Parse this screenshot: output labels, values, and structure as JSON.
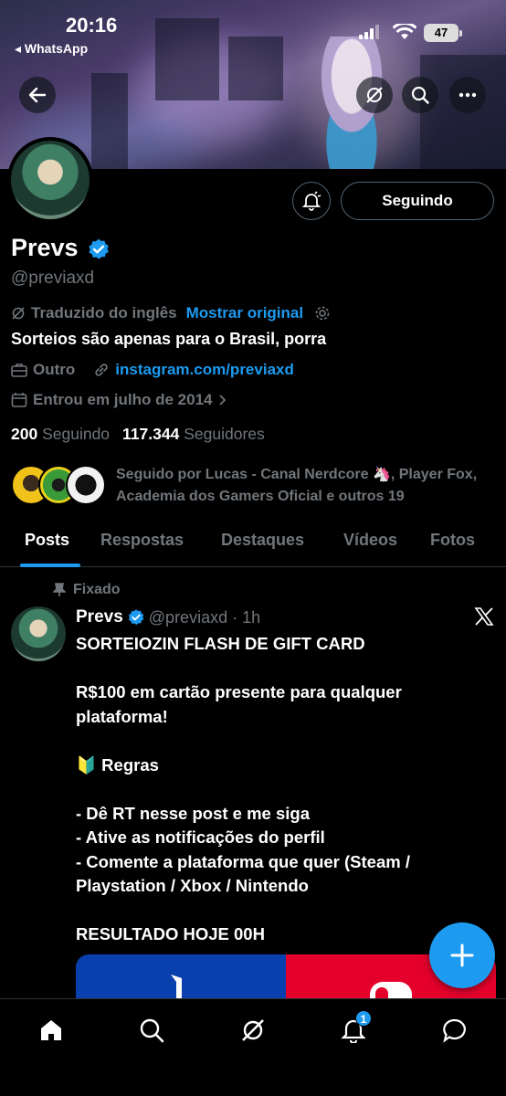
{
  "status_bar": {
    "time": "20:16",
    "back_app": "◂ WhatsApp",
    "battery": "47"
  },
  "profile": {
    "name": "Prevs",
    "handle": "@previaxd",
    "translated_from": "Traduzido do inglês",
    "show_original": "Mostrar original",
    "bio": "Sorteios são apenas para o Brasil, porra",
    "category": "Outro",
    "website": "instagram.com/previaxd",
    "joined": "Entrou em julho de 2014",
    "following_count": "200",
    "following_label": "Seguindo",
    "followers_count": "117.344",
    "followers_label": "Seguidores",
    "follow_button": "Seguindo",
    "followed_by": "Seguido por Lucas - Canal Nerdcore 🦄, Player Fox, Academia dos Gamers Oficial e outros 19"
  },
  "tabs": [
    "Posts",
    "Respostas",
    "Destaques",
    "Vídeos",
    "Fotos"
  ],
  "post": {
    "pinned_label": "Fixado",
    "author": "Prevs",
    "handle_time": "@previaxd · 1h",
    "lines": [
      "SORTEIOZIN FLASH DE GIFT CARD",
      "",
      "R$100 em cartão presente para qualquer plataforma!",
      "",
      "🔰 Regras",
      "",
      "- Dê RT nesse post e me siga",
      "- Ative as notificações do perfil",
      "- Comente a plataforma que quer (Steam / Playstation / Xbox / Nintendo",
      "",
      "RESULTADO HOJE 00H"
    ]
  },
  "nav": {
    "notifications_badge": "1"
  },
  "colors": {
    "accent": "#1d9bf0",
    "background": "#000000",
    "muted": "#71767b"
  }
}
